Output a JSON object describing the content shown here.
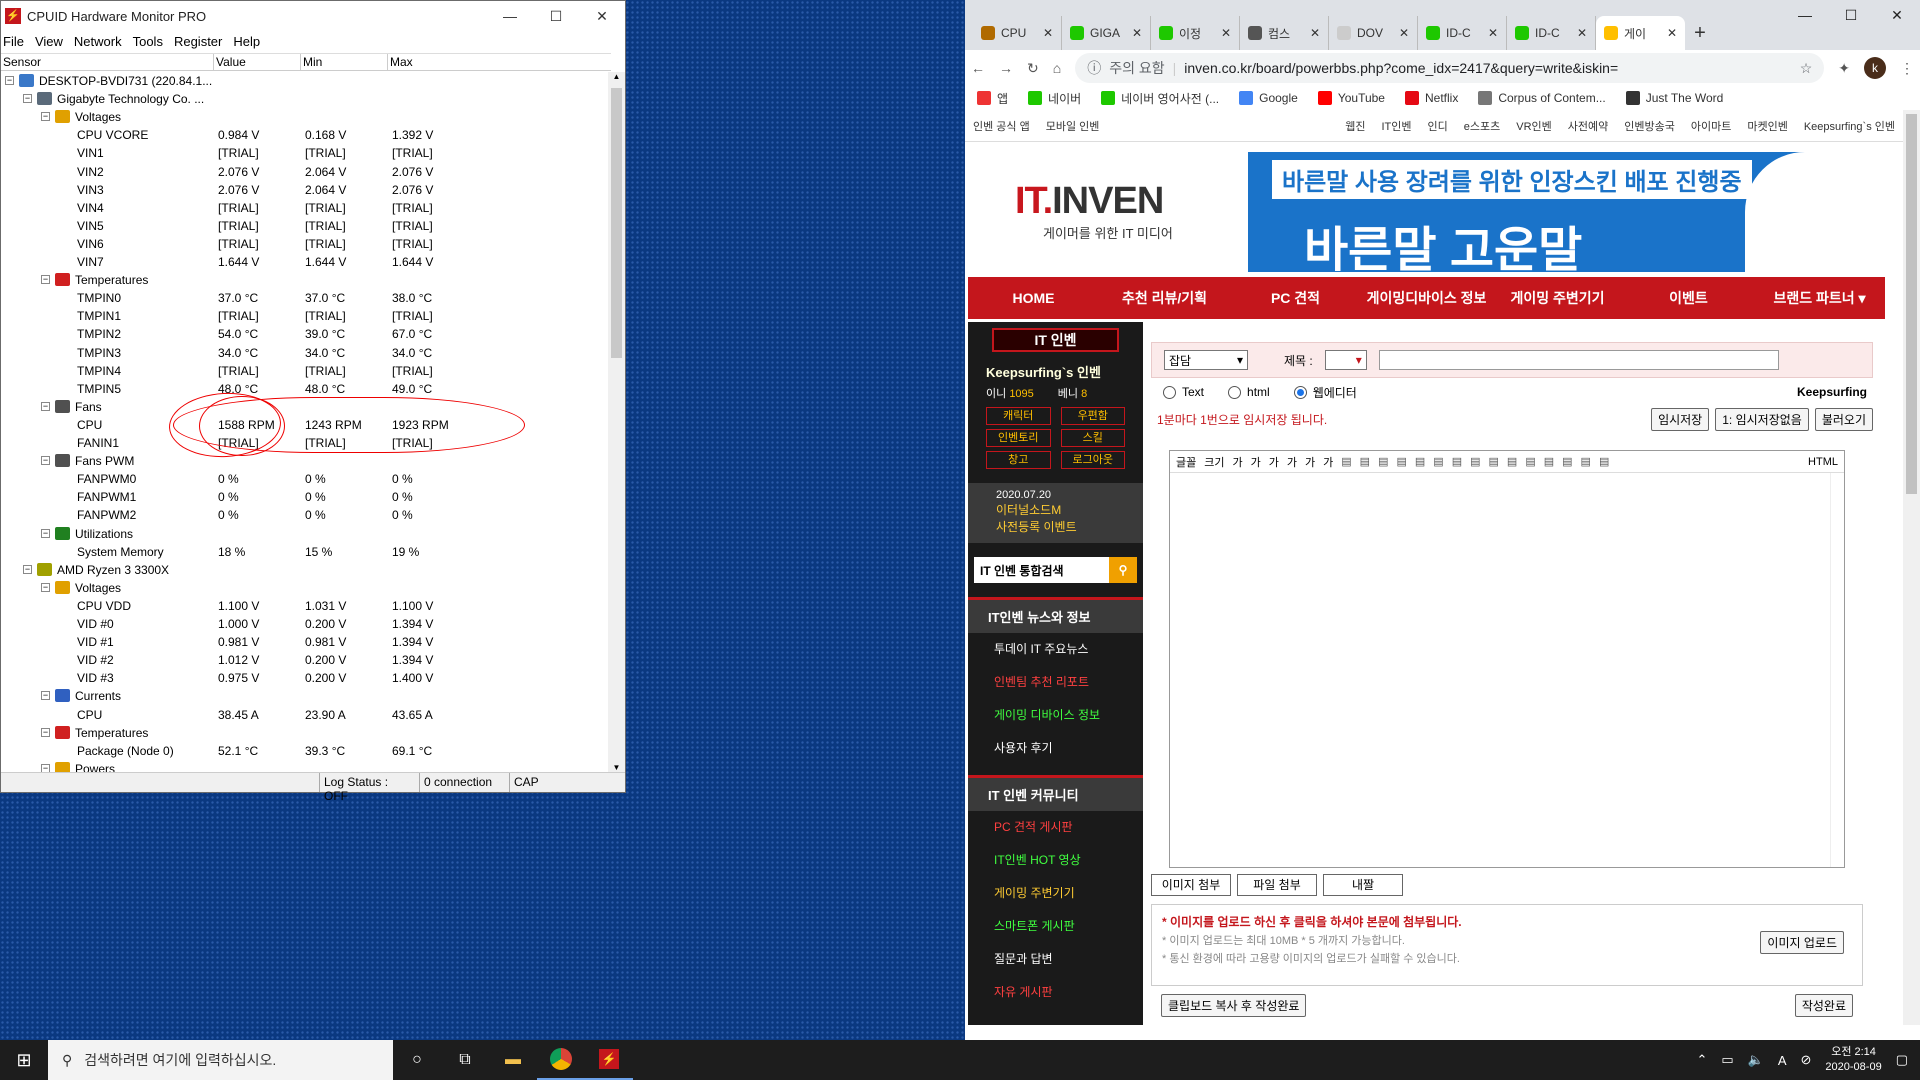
{
  "hwmonitor": {
    "title": "CPUID Hardware Monitor PRO",
    "menu": [
      "File",
      "View",
      "Network",
      "Tools",
      "Register",
      "Help"
    ],
    "columns": [
      "Sensor",
      "Value",
      "Min",
      "Max"
    ],
    "rows": [
      {
        "level": 0,
        "kind": "node",
        "icon": "computer-icon",
        "name": "DESKTOP-BVDI731 (220.84.1...",
        "v": "",
        "mn": "",
        "mx": ""
      },
      {
        "level": 1,
        "kind": "node",
        "icon": "motherboard-icon",
        "name": "Gigabyte Technology Co. ...",
        "v": "",
        "mn": "",
        "mx": ""
      },
      {
        "level": 2,
        "kind": "node",
        "icon": "voltage-icon",
        "name": "Voltages",
        "v": "",
        "mn": "",
        "mx": ""
      },
      {
        "level": 3,
        "kind": "leaf",
        "name": "CPU VCORE",
        "v": "0.984 V",
        "mn": "0.168 V",
        "mx": "1.392 V"
      },
      {
        "level": 3,
        "kind": "leaf",
        "name": "VIN1",
        "v": "[TRIAL]",
        "mn": "[TRIAL]",
        "mx": "[TRIAL]"
      },
      {
        "level": 3,
        "kind": "leaf",
        "name": "VIN2",
        "v": "2.076 V",
        "mn": "2.064 V",
        "mx": "2.076 V"
      },
      {
        "level": 3,
        "kind": "leaf",
        "name": "VIN3",
        "v": "2.076 V",
        "mn": "2.064 V",
        "mx": "2.076 V"
      },
      {
        "level": 3,
        "kind": "leaf",
        "name": "VIN4",
        "v": "[TRIAL]",
        "mn": "[TRIAL]",
        "mx": "[TRIAL]"
      },
      {
        "level": 3,
        "kind": "leaf",
        "name": "VIN5",
        "v": "[TRIAL]",
        "mn": "[TRIAL]",
        "mx": "[TRIAL]"
      },
      {
        "level": 3,
        "kind": "leaf",
        "name": "VIN6",
        "v": "[TRIAL]",
        "mn": "[TRIAL]",
        "mx": "[TRIAL]"
      },
      {
        "level": 3,
        "kind": "leaf",
        "name": "VIN7",
        "v": "1.644 V",
        "mn": "1.644 V",
        "mx": "1.644 V"
      },
      {
        "level": 2,
        "kind": "node",
        "icon": "thermometer-icon",
        "name": "Temperatures",
        "v": "",
        "mn": "",
        "mx": ""
      },
      {
        "level": 3,
        "kind": "leaf",
        "name": "TMPIN0",
        "v": "37.0 °C",
        "mn": "37.0 °C",
        "mx": "38.0 °C"
      },
      {
        "level": 3,
        "kind": "leaf",
        "name": "TMPIN1",
        "v": "[TRIAL]",
        "mn": "[TRIAL]",
        "mx": "[TRIAL]"
      },
      {
        "level": 3,
        "kind": "leaf",
        "name": "TMPIN2",
        "v": "54.0 °C",
        "mn": "39.0 °C",
        "mx": "67.0 °C"
      },
      {
        "level": 3,
        "kind": "leaf",
        "name": "TMPIN3",
        "v": "34.0 °C",
        "mn": "34.0 °C",
        "mx": "34.0 °C"
      },
      {
        "level": 3,
        "kind": "leaf",
        "name": "TMPIN4",
        "v": "[TRIAL]",
        "mn": "[TRIAL]",
        "mx": "[TRIAL]"
      },
      {
        "level": 3,
        "kind": "leaf",
        "name": "TMPIN5",
        "v": "48.0 °C",
        "mn": "48.0 °C",
        "mx": "49.0 °C"
      },
      {
        "level": 2,
        "kind": "node",
        "icon": "fan-icon",
        "name": "Fans",
        "v": "",
        "mn": "",
        "mx": ""
      },
      {
        "level": 3,
        "kind": "leaf",
        "name": "CPU",
        "v": "1588 RPM",
        "mn": "1243 RPM",
        "mx": "1923 RPM"
      },
      {
        "level": 3,
        "kind": "leaf",
        "name": "FANIN1",
        "v": "[TRIAL]",
        "mn": "[TRIAL]",
        "mx": "[TRIAL]"
      },
      {
        "level": 2,
        "kind": "node",
        "icon": "fan-icon",
        "name": "Fans PWM",
        "v": "",
        "mn": "",
        "mx": ""
      },
      {
        "level": 3,
        "kind": "leaf",
        "name": "FANPWM0",
        "v": "0 %",
        "mn": "0 %",
        "mx": "0 %"
      },
      {
        "level": 3,
        "kind": "leaf",
        "name": "FANPWM1",
        "v": "0 %",
        "mn": "0 %",
        "mx": "0 %"
      },
      {
        "level": 3,
        "kind": "leaf",
        "name": "FANPWM2",
        "v": "0 %",
        "mn": "0 %",
        "mx": "0 %"
      },
      {
        "level": 2,
        "kind": "node",
        "icon": "utilization-icon",
        "name": "Utilizations",
        "v": "",
        "mn": "",
        "mx": ""
      },
      {
        "level": 3,
        "kind": "leaf",
        "name": "System Memory",
        "v": "18 %",
        "mn": "15 %",
        "mx": "19 %"
      },
      {
        "level": 1,
        "kind": "node",
        "icon": "cpu-chip-icon",
        "name": "AMD Ryzen 3 3300X",
        "v": "",
        "mn": "",
        "mx": ""
      },
      {
        "level": 2,
        "kind": "node",
        "icon": "voltage-icon",
        "name": "Voltages",
        "v": "",
        "mn": "",
        "mx": ""
      },
      {
        "level": 3,
        "kind": "leaf",
        "name": "CPU VDD",
        "v": "1.100 V",
        "mn": "1.031 V",
        "mx": "1.100 V"
      },
      {
        "level": 3,
        "kind": "leaf",
        "name": "VID #0",
        "v": "1.000 V",
        "mn": "0.200 V",
        "mx": "1.394 V"
      },
      {
        "level": 3,
        "kind": "leaf",
        "name": "VID #1",
        "v": "0.981 V",
        "mn": "0.981 V",
        "mx": "1.394 V"
      },
      {
        "level": 3,
        "kind": "leaf",
        "name": "VID #2",
        "v": "1.012 V",
        "mn": "0.200 V",
        "mx": "1.394 V"
      },
      {
        "level": 3,
        "kind": "leaf",
        "name": "VID #3",
        "v": "0.975 V",
        "mn": "0.200 V",
        "mx": "1.400 V"
      },
      {
        "level": 2,
        "kind": "node",
        "icon": "current-icon",
        "name": "Currents",
        "v": "",
        "mn": "",
        "mx": ""
      },
      {
        "level": 3,
        "kind": "leaf",
        "name": "CPU",
        "v": "38.45 A",
        "mn": "23.90 A",
        "mx": "43.65 A"
      },
      {
        "level": 2,
        "kind": "node",
        "icon": "thermometer-icon",
        "name": "Temperatures",
        "v": "",
        "mn": "",
        "mx": ""
      },
      {
        "level": 3,
        "kind": "leaf",
        "name": "Package (Node 0)",
        "v": "52.1 °C",
        "mn": "39.3 °C",
        "mx": "69.1 °C"
      },
      {
        "level": 2,
        "kind": "node",
        "icon": "power-icon",
        "name": "Powers",
        "v": "",
        "mn": "",
        "mx": ""
      }
    ],
    "status": [
      "Log Status : OFF",
      "0 connection",
      "CAP"
    ]
  },
  "chrome": {
    "tabs": [
      {
        "label": "CPU",
        "color": "#b06a00"
      },
      {
        "label": "GIGA",
        "color": "#1ec800"
      },
      {
        "label": "이정",
        "color": "#1ec800"
      },
      {
        "label": "컴스",
        "color": "#555555"
      },
      {
        "label": "DOV",
        "color": "#cccccc"
      },
      {
        "label": "ID-C",
        "color": "#1ec800"
      },
      {
        "label": "ID-C",
        "color": "#1ec800"
      },
      {
        "label": "게이",
        "color": "#ffbf00"
      }
    ],
    "url_secure": "주의 요함",
    "url": "inven.co.kr/board/powerbbs.php?come_idx=2417&query=write&iskin=",
    "avatar": "k",
    "bookmarks": [
      {
        "label": "앱",
        "color": "#e33"
      },
      {
        "label": "네이버",
        "color": "#1ec800"
      },
      {
        "label": "네이버 영어사전 (...",
        "color": "#1ec800"
      },
      {
        "label": "Google",
        "color": "#4285f4"
      },
      {
        "label": "YouTube",
        "color": "#ff0000"
      },
      {
        "label": "Netflix",
        "color": "#e50914"
      },
      {
        "label": "Corpus of Contem...",
        "color": "#777777"
      },
      {
        "label": "Just The Word",
        "color": "#333333"
      }
    ],
    "topbar_left": [
      "인벤 공식 앱",
      "모바일 인벤"
    ],
    "topbar_right": [
      "웹진",
      "IT인벤",
      "인디",
      "e스포츠",
      "VR인벤",
      "사전예약",
      "인벤방송국",
      "아이마트",
      "마켓인벤",
      "Keepsurfing`s 인벤"
    ],
    "logo": {
      "part1": "IT",
      "part2": "INVEN",
      "sub": "게이머를 위한 IT 미디어"
    },
    "banner": {
      "line1": "바른말 사용 장려를 위한 인장스킨 배포 진행중",
      "line2": "바른말 고운말"
    },
    "nav": [
      "HOME",
      "추천 리뷰/기획",
      "PC 견적",
      "게이밍디바이스 정보",
      "게이밍 주변기기",
      "이벤트",
      "브랜드 파트너 ▾"
    ],
    "side": {
      "title": "IT 인벤",
      "user": "Keepsurfing`s 인벤",
      "ini_label": "이니",
      "ini": "1095",
      "beni_label": "베니",
      "beni": "8",
      "buttons": [
        "캐릭터",
        "우편함",
        "인벤토리",
        "스킬",
        "창고",
        "로그아웃"
      ],
      "event_date": "2020.07.20",
      "event_title": "이터널소드M",
      "event_sub": "사전등록 이벤트",
      "search": "IT 인벤 통합검색",
      "news_header": "IT인벤 뉴스와 정보",
      "news": [
        "투데이 IT 주요뉴스",
        "인벤팀 추천 리포트",
        "게이밍 디바이스 정보",
        "사용자 후기"
      ],
      "comm_header": "IT 인벤 커뮤니티",
      "comm": [
        "PC 견적 게시판",
        "IT인벤 HOT 영상",
        "게이밍 주변기기",
        "스마트폰 게시판",
        "질문과 답변",
        "자유 게시판"
      ]
    },
    "form": {
      "category": "잡담",
      "subject_label": "제목 :",
      "radios": [
        "Text",
        "html",
        "웹에디터"
      ],
      "writer": "Keepsurfing",
      "notice": "1분마다 1번으로 임시저장 됩니다.",
      "tmp_save": "임시저장",
      "tmp_select": "1: 임시저장없음",
      "load": "불러오기",
      "toolbar": [
        "글꼴",
        "크기",
        "가",
        "가",
        "가",
        "가",
        "가",
        "가"
      ],
      "html_label": "HTML",
      "attach": [
        "이미지 첨부",
        "파일 첨부",
        "내짤"
      ],
      "up1": "* 이미지를 업로드 하신 후 클릭을 하셔야 본문에 첨부됩니다.",
      "up2": "* 이미지 업로드는 최대 10MB * 5 개까지 가능합니다.",
      "up3": "* 통신 환경에 따라 고용량 이미지의 업로드가 실패할 수 있습니다.",
      "upload_btn": "이미지 업로드",
      "clip_btn": "클립보드 복사 후 작성완료",
      "done_btn": "작성완료"
    }
  },
  "taskbar": {
    "search": "검색하려면 여기에 입력하십시오.",
    "time": "오전 2:14",
    "date": "2020-08-09"
  }
}
